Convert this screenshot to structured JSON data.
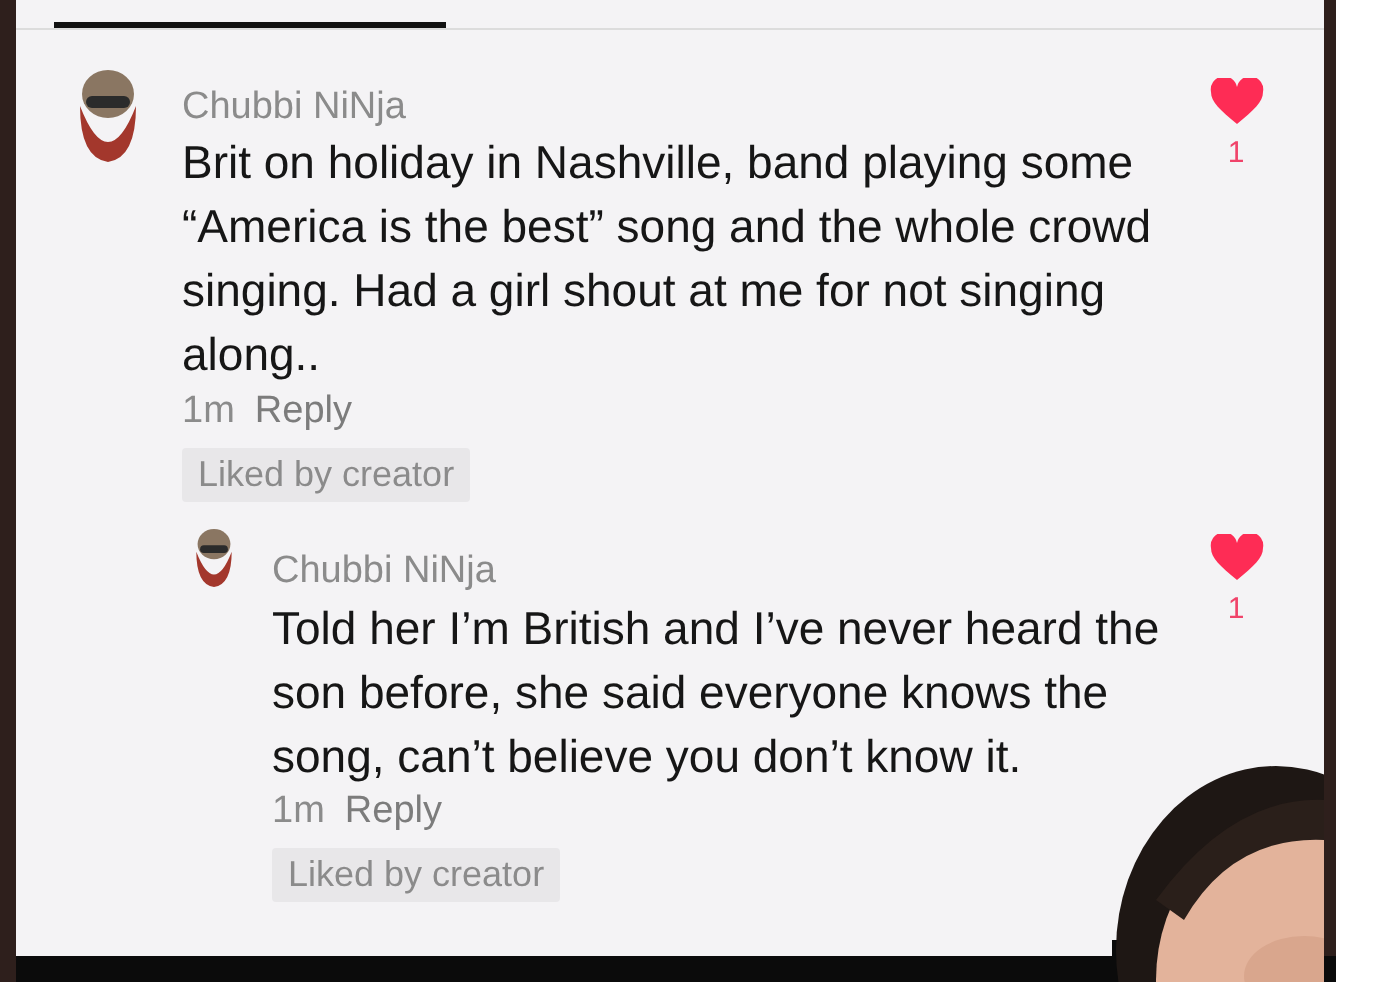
{
  "comments": [
    {
      "author": "Chubbi NiNja",
      "text": "Brit on holiday in Nashville, band playing some “America is the best” song and the whole crowd singing. Had a girl shout at me for not singing along..",
      "time": "1m",
      "reply_label": "Reply",
      "badge": "Liked by creator",
      "liked": true,
      "likes": "1",
      "kind": "comment"
    },
    {
      "author": "Chubbi NiNja",
      "text": "Told her I’m British and I’ve never heard the son before, she said everyone knows the song, can’t believe you don’t know it.",
      "time": "1m",
      "reply_label": "Reply",
      "badge": "Liked by creator",
      "liked": true,
      "likes": "1",
      "kind": "reply"
    }
  ]
}
